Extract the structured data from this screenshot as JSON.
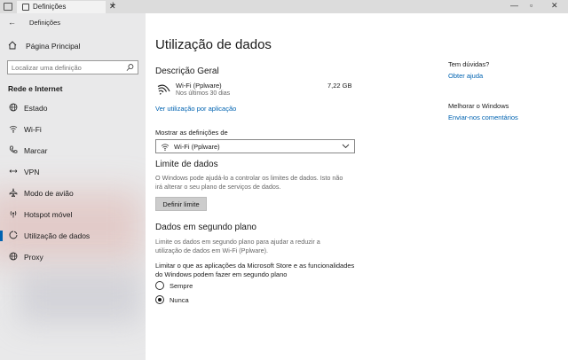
{
  "window": {
    "tab_title": "Definições",
    "tab_close": "✕",
    "new_tab": "+",
    "minimize": "—",
    "maximize": "▫",
    "close": "✕"
  },
  "sidebar": {
    "back": "←",
    "app_title": "Definições",
    "home_label": "Página Principal",
    "search_placeholder": "Localizar uma definição",
    "section": "Rede e Internet",
    "items": [
      {
        "label": "Estado",
        "icon": "globe-icon"
      },
      {
        "label": "Wi-Fi",
        "icon": "wifi-icon"
      },
      {
        "label": "Marcar",
        "icon": "phone-icon"
      },
      {
        "label": "VPN",
        "icon": "vpn-icon"
      },
      {
        "label": "Modo de avião",
        "icon": "airplane-icon"
      },
      {
        "label": "Hotspot móvel",
        "icon": "hotspot-icon"
      },
      {
        "label": "Utilização de dados",
        "icon": "data-usage-icon",
        "active": true
      },
      {
        "label": "Proxy",
        "icon": "proxy-icon"
      }
    ]
  },
  "main": {
    "title": "Utilização de dados",
    "overview": {
      "heading": "Descrição Geral",
      "network_name": "Wi-Fi (Pplware)",
      "period": "Nos últimos 30 dias",
      "usage": "7,22 GB",
      "link": "Ver utilização por aplicação"
    },
    "show_settings": {
      "label": "Mostrar as definições de",
      "selected": "Wi-Fi (Pplware)"
    },
    "data_limit": {
      "heading": "Limite de dados",
      "desc_line1": "O Windows pode ajudá-lo a controlar os limites de dados. Isto não",
      "desc_line2": "irá alterar o seu plano de serviços de dados.",
      "button": "Definir limite"
    },
    "background": {
      "heading": "Dados em segundo plano",
      "desc_line1": "Limite os dados em segundo plano para ajudar a reduzir a",
      "desc_line2": "utilização de dados em Wi-Fi (Pplware).",
      "question_line1": "Limitar o que as aplicações da Microsoft Store e as funcionalidades",
      "question_line2": "do Windows podem fazer em segundo plano",
      "options": [
        {
          "label": "Sempre",
          "selected": false
        },
        {
          "label": "Nunca",
          "selected": true
        }
      ]
    }
  },
  "help": {
    "questions_heading": "Tem dúvidas?",
    "questions_link": "Obter ajuda",
    "improve_heading": "Melhorar o Windows",
    "improve_link": "Enviar-nos comentários"
  },
  "colors": {
    "accent": "#0063b1",
    "sidebar_bg": "#e9e9ea"
  }
}
